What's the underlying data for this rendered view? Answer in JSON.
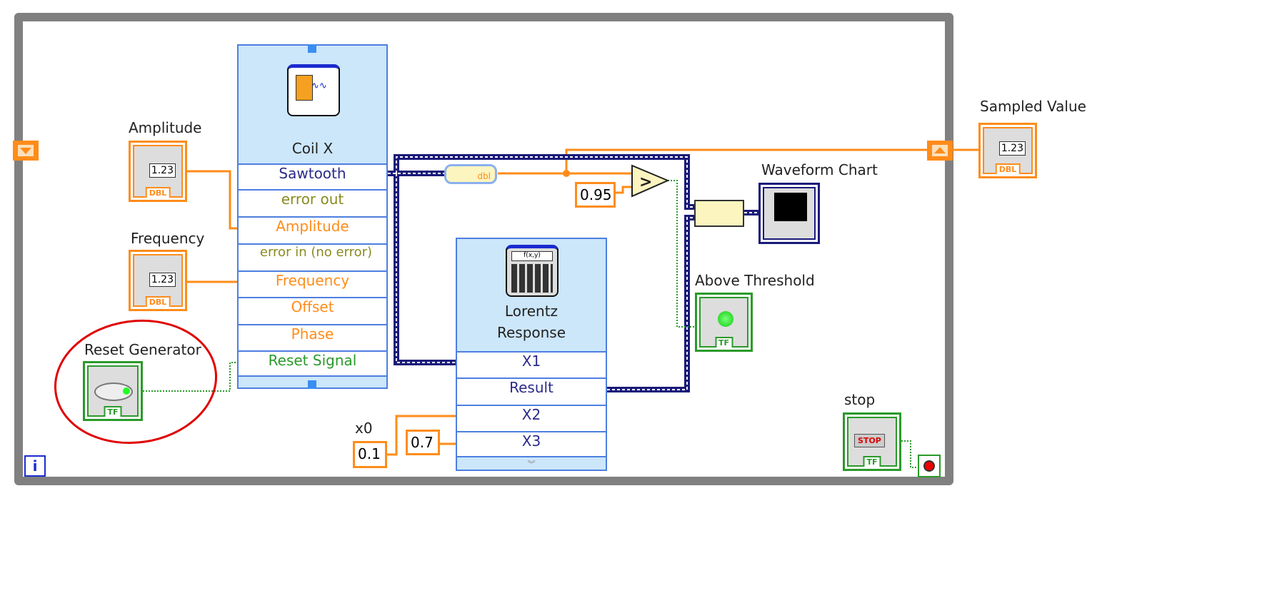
{
  "loop": {
    "iteration_terminal": "i"
  },
  "controls": {
    "amplitude": {
      "label": "Amplitude",
      "value": "1.23",
      "type": "DBL"
    },
    "frequency": {
      "label": "Frequency",
      "value": "1.23",
      "type": "DBL"
    },
    "reset_generator": {
      "label": "Reset Generator",
      "type": "TF"
    },
    "stop": {
      "label": "stop",
      "button_text": "STOP",
      "type": "TF"
    }
  },
  "indicators": {
    "sampled_value": {
      "label": "Sampled Value",
      "value": "1.23",
      "type": "DBL"
    },
    "waveform_chart": {
      "label": "Waveform Chart"
    },
    "above_threshold": {
      "label": "Above Threshold",
      "type": "TF"
    }
  },
  "coil_node": {
    "title": "Coil X",
    "rows": [
      "Sawtooth",
      "error out",
      "Amplitude",
      "error in (no error)",
      "Frequency",
      "Offset",
      "Phase",
      "Reset Signal"
    ]
  },
  "lorentz_node": {
    "title": "Lorentz Response",
    "rows": [
      "X1",
      "Result",
      "X2",
      "X3"
    ]
  },
  "convert_node": {
    "label": "dbl"
  },
  "constants": {
    "threshold": "0.95",
    "x0_label": "x0",
    "x0": "0.1",
    "x3": "0.7"
  },
  "colors": {
    "dbl_wire": "#ff8c1a",
    "waveform_wire": "#1a1a7a",
    "bool_wire": "#2a9a2a",
    "node_fill": "#cce6fa",
    "node_border": "#4d7fe0",
    "annotation": "#e00000"
  }
}
